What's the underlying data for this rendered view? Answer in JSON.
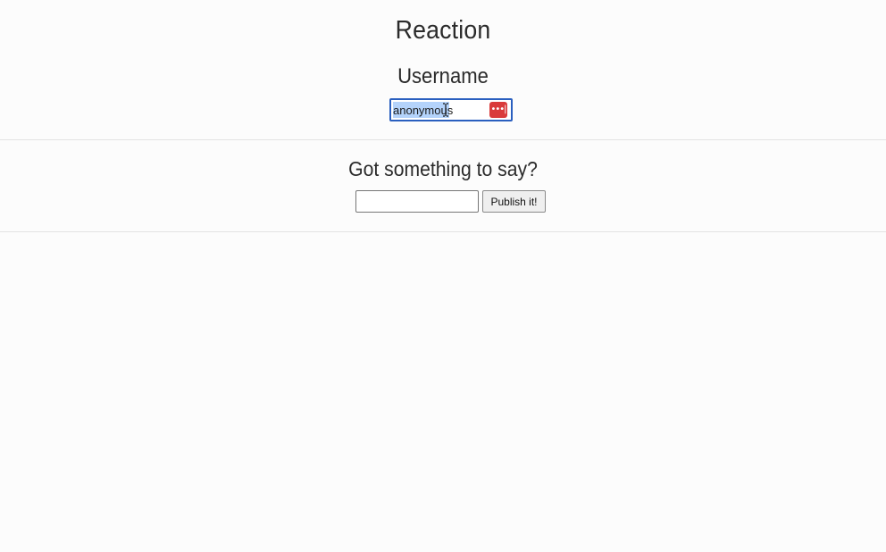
{
  "app": {
    "title": "Reaction"
  },
  "username": {
    "label": "Username",
    "value": "anonymous",
    "password_manager_icon": "password-manager-icon",
    "password_manager_glyph": "•••|"
  },
  "composer": {
    "heading": "Got something to say?",
    "message_value": "",
    "publish_label": "Publish it!"
  },
  "colors": {
    "focus_border": "#2a5fbf",
    "selection": "#b4d3fb",
    "password_manager": "#d93b3b"
  }
}
